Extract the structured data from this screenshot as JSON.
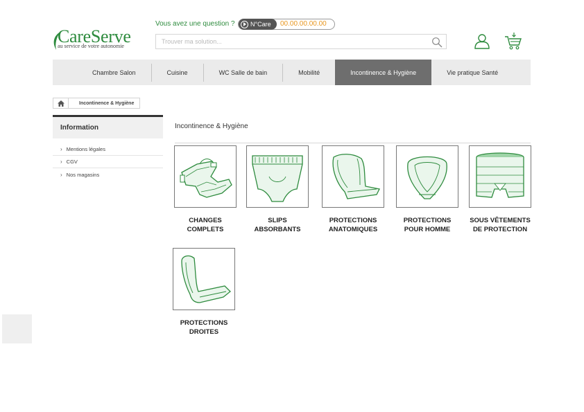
{
  "header": {
    "logo_name": "CareServe",
    "logo_tagline": "au service de votre autonomie",
    "question": "Vous avez une question ?",
    "phone_badge": "N°Care",
    "phone_number": "00.00.00.00.00",
    "search_placeholder": "Trouver ma solution..."
  },
  "nav": {
    "items": [
      {
        "label": "Chambre Salon"
      },
      {
        "label": "Cuisine"
      },
      {
        "label": "WC Salle de bain"
      },
      {
        "label": "Mobilité"
      },
      {
        "label": "Incontinence & Hygiène"
      },
      {
        "label": "Vie pratique Santé"
      }
    ],
    "active": "Incontinence & Hygiène"
  },
  "breadcrumb": {
    "current": "Incontinence & Hygiène"
  },
  "sidebar": {
    "title": "Information",
    "links": [
      "Mentions légales",
      "CGV",
      "Nos magasins"
    ]
  },
  "main": {
    "title": "Incontinence & Hygiène",
    "products": [
      {
        "line1": "CHANGES",
        "line2": "COMPLETS",
        "icon": "diaper-icon"
      },
      {
        "line1": "SLIPS",
        "line2": "ABSORBANTS",
        "icon": "pull-up-pants-icon"
      },
      {
        "line1": "PROTECTIONS",
        "line2": "ANATOMIQUES",
        "icon": "anatomic-pad-icon"
      },
      {
        "line1": "PROTECTIONS",
        "line2": "POUR HOMME",
        "icon": "male-pad-icon"
      },
      {
        "line1": "SOUS VÊTEMENTS",
        "line2": "DE PROTECTION",
        "icon": "mesh-pants-icon"
      },
      {
        "line1": "PROTECTIONS",
        "line2": "DROITES",
        "icon": "straight-pad-icon"
      }
    ]
  },
  "colors": {
    "brand_green": "#2e8b3e",
    "phone_orange": "#e8961e",
    "nav_active": "#6e6e6e"
  }
}
